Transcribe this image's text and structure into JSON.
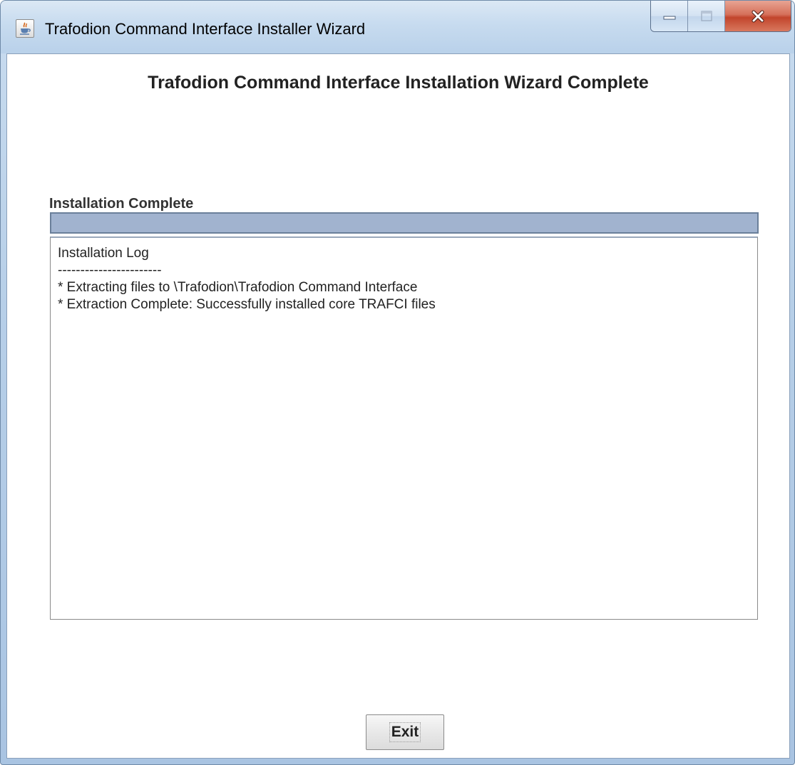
{
  "window": {
    "title": "Trafodion Command Interface Installer Wizard",
    "icon": "java-icon"
  },
  "caption_buttons": {
    "minimize": "minimize-icon",
    "maximize": "maximize-icon",
    "close": "close-icon"
  },
  "main": {
    "heading": "Trafodion Command Interface Installation Wizard Complete",
    "section_label": "Installation Complete",
    "progress": {
      "percent": 100,
      "fill_color": "#a1b3cf"
    },
    "log_lines": [
      "Installation Log",
      "-----------------------",
      "* Extracting files to \\Trafodion\\Trafodion Command Interface",
      "* Extraction Complete: Successfully installed core TRAFCI files"
    ]
  },
  "footer": {
    "exit_label": "Exit"
  },
  "colors": {
    "close_button": "#c2452c",
    "title_bar": "#c7dbef"
  }
}
